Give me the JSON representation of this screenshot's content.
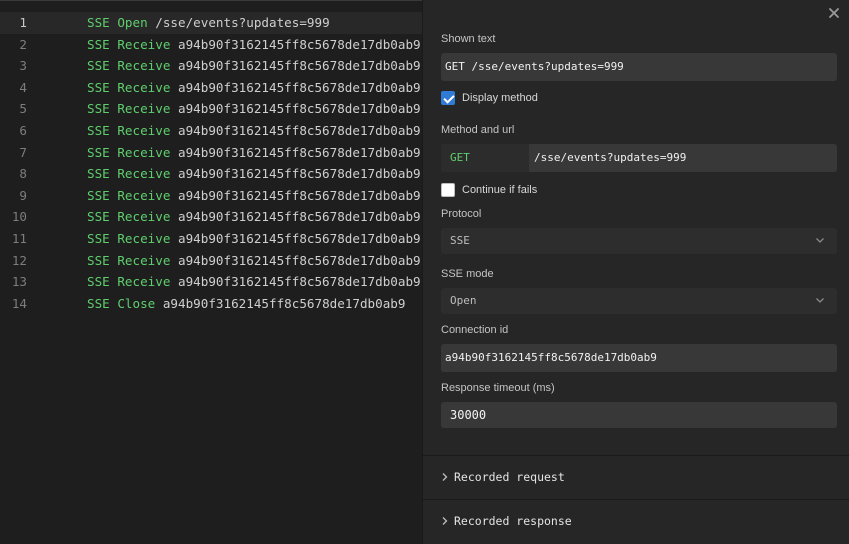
{
  "editor": {
    "lines": [
      {
        "num": "1",
        "keyword": "SSE Open",
        "arg": "/sse/events?updates=999"
      },
      {
        "num": "2",
        "keyword": "SSE Receive",
        "arg": "a94b90f3162145ff8c5678de17db0ab9"
      },
      {
        "num": "3",
        "keyword": "SSE Receive",
        "arg": "a94b90f3162145ff8c5678de17db0ab9"
      },
      {
        "num": "4",
        "keyword": "SSE Receive",
        "arg": "a94b90f3162145ff8c5678de17db0ab9"
      },
      {
        "num": "5",
        "keyword": "SSE Receive",
        "arg": "a94b90f3162145ff8c5678de17db0ab9"
      },
      {
        "num": "6",
        "keyword": "SSE Receive",
        "arg": "a94b90f3162145ff8c5678de17db0ab9"
      },
      {
        "num": "7",
        "keyword": "SSE Receive",
        "arg": "a94b90f3162145ff8c5678de17db0ab9"
      },
      {
        "num": "8",
        "keyword": "SSE Receive",
        "arg": "a94b90f3162145ff8c5678de17db0ab9"
      },
      {
        "num": "9",
        "keyword": "SSE Receive",
        "arg": "a94b90f3162145ff8c5678de17db0ab9"
      },
      {
        "num": "10",
        "keyword": "SSE Receive",
        "arg": "a94b90f3162145ff8c5678de17db0ab9"
      },
      {
        "num": "11",
        "keyword": "SSE Receive",
        "arg": "a94b90f3162145ff8c5678de17db0ab9"
      },
      {
        "num": "12",
        "keyword": "SSE Receive",
        "arg": "a94b90f3162145ff8c5678de17db0ab9"
      },
      {
        "num": "13",
        "keyword": "SSE Receive",
        "arg": "a94b90f3162145ff8c5678de17db0ab9"
      },
      {
        "num": "14",
        "keyword": "SSE Close",
        "arg": "a94b90f3162145ff8c5678de17db0ab9"
      }
    ],
    "active_line": 1
  },
  "panel": {
    "close_icon": "close-icon",
    "shown_text": {
      "label": "Shown text",
      "value": "GET /sse/events?updates=999"
    },
    "display_method": {
      "label": "Display method",
      "checked": true
    },
    "method_url": {
      "label": "Method and url",
      "method": "GET",
      "url": "/sse/events?updates=999"
    },
    "continue_if_fails": {
      "label": "Continue if fails",
      "checked": false
    },
    "protocol": {
      "label": "Protocol",
      "value": "SSE"
    },
    "sse_mode": {
      "label": "SSE mode",
      "value": "Open"
    },
    "connection_id": {
      "label": "Connection id",
      "value": "a94b90f3162145ff8c5678de17db0ab9"
    },
    "response_timeout": {
      "label": "Response timeout (ms)",
      "value": "30000"
    },
    "sections": [
      {
        "title": "Recorded request"
      },
      {
        "title": "Recorded response"
      }
    ]
  },
  "colors": {
    "keyword": "#5fcf6e",
    "accent": "#2f7bd6"
  }
}
